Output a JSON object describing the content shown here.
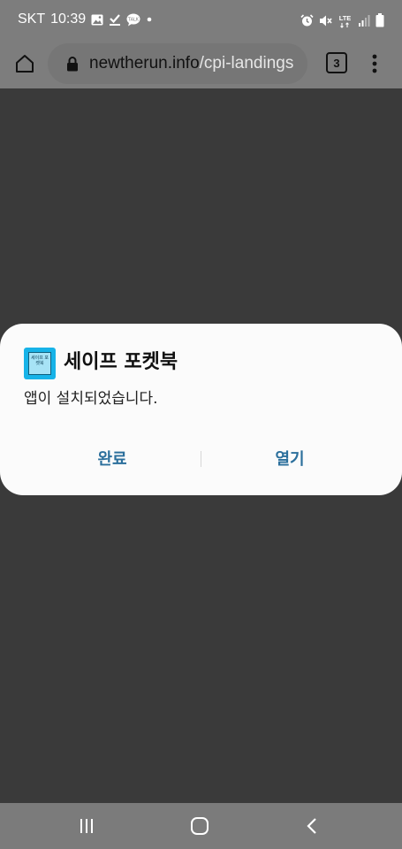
{
  "status_bar": {
    "carrier": "SKT",
    "time": "10:39",
    "network": "LTE"
  },
  "browser": {
    "url_domain": "newtherun.info",
    "url_path": "/cpi-landings",
    "tab_count": "3"
  },
  "dialog": {
    "app_name": "세이프 포켓북",
    "app_icon_text": "세이프 포켓북",
    "message": "앱이 설치되었습니다.",
    "done_label": "완료",
    "open_label": "열기"
  },
  "colors": {
    "accent": "#2b6f9c",
    "dialog_bg": "#fbfbfb",
    "overlay": "#3a3a3a",
    "app_icon": "#17b3e8"
  }
}
